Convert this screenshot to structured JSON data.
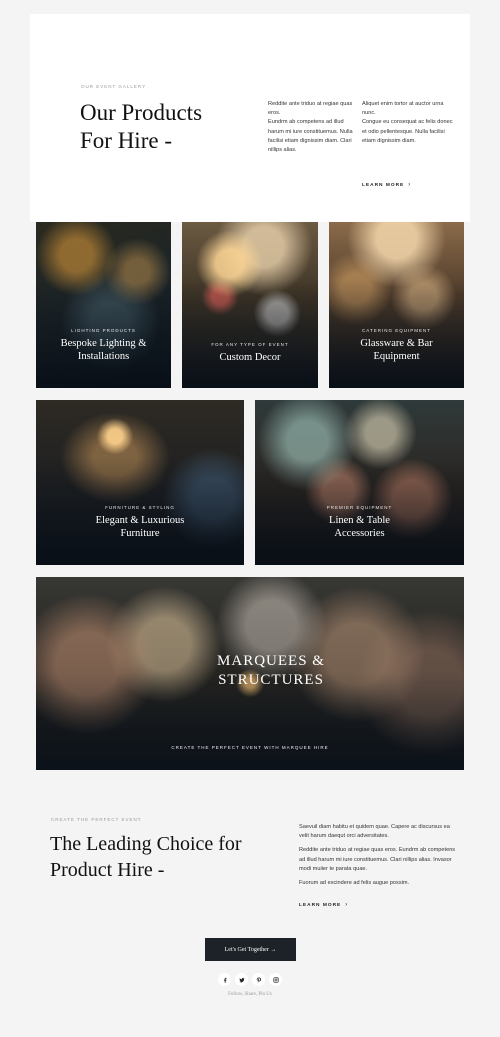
{
  "intro": {
    "eyebrow": "Our Event Gallery",
    "title": "Our Products For Hire -",
    "col1": [
      "Reddite ante triduo at regiae quas eros.",
      "Eundrm ab competens ad illud harum mi iure constituemus. Nulla facilisi etiam dignissim diam. Clari nillips alias."
    ],
    "col2": [
      "Aliquet enim tortor at auctor urna nunc.",
      "Congue eu consequat ac felis donec et odio pellentesque. Nulla facilisi etiam dignissim diam."
    ],
    "learn_more": "Learn more",
    "arrow": "›"
  },
  "products": [
    {
      "eyebrow": "Lighting Products",
      "title": "Bespoke Lighting & Installations"
    },
    {
      "eyebrow": "For any type of event",
      "title": "Custom Decor"
    },
    {
      "eyebrow": "Catering Equipment",
      "title": "Glassware & Bar Equipment"
    },
    {
      "eyebrow": "Furniture & Styling",
      "title": "Elegant & Luxurious Furniture"
    },
    {
      "eyebrow": "Premier Equipment",
      "title": "Linen & Table Accessories"
    }
  ],
  "marquee": {
    "title": "Marquees & Structures",
    "eyebrow": "Create the perfect event with marquee hire"
  },
  "leading": {
    "eyebrow": "Create the perfect event",
    "title": "The Leading Choice for Product Hire -",
    "paragraphs": [
      "Saevuil diam habitu et quidem quae. Capere ac discursus ea velit harum daequt orci adversitates.",
      "Reddite ante triduo at regiae quas eros. Eundrm ab competens ad illud harum mi iure constituemus. Clari nillips alias. Invasor modi muiier te parata quae.",
      "Fuorum ad excindere ad felis augue possim."
    ],
    "learn_more": "Learn more",
    "arrow": "›"
  },
  "cta": {
    "label": "Let's Get Together →"
  },
  "social": {
    "icons": [
      "facebook-icon",
      "twitter-icon",
      "pinterest-icon",
      "instagram-icon"
    ],
    "follow_text": "Follow, Share, Pin Us"
  },
  "colors": {
    "background": "#f4f4f4",
    "card": "#ffffff",
    "cta_bg": "#1c2227",
    "text_dark": "#111111"
  }
}
